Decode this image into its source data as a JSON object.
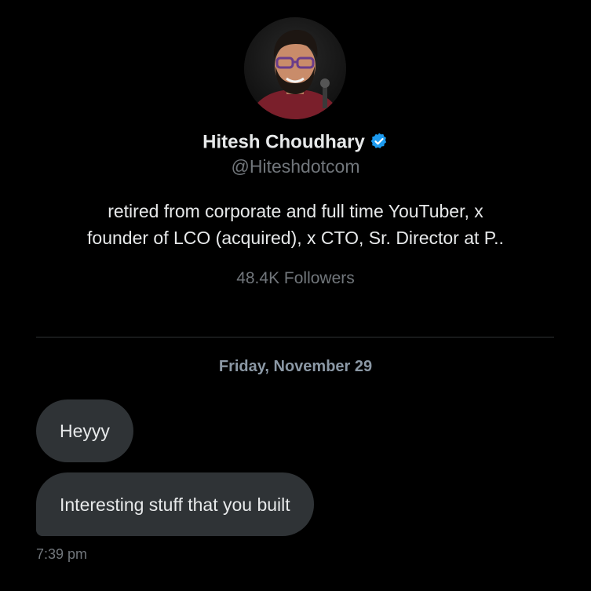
{
  "profile": {
    "name": "Hitesh Choudhary",
    "handle": "@Hiteshdotcom",
    "bio_line1": "retired from corporate and full time YouTuber, x",
    "bio_line2": "founder of LCO (acquired), x CTO, Sr. Director at P..",
    "followers": "48.4K Followers",
    "verified_color": "#1d9bf0",
    "avatar_icon": "profile-photo"
  },
  "conversation": {
    "date": "Friday, November 29",
    "messages": [
      {
        "text": "Heyyy"
      },
      {
        "text": "Interesting stuff that you built"
      }
    ],
    "timestamp": "7:39 pm"
  },
  "colors": {
    "background": "#000000",
    "bubble": "#2f3336",
    "primary_text": "#e7e9ea",
    "secondary_text": "#71767b"
  }
}
